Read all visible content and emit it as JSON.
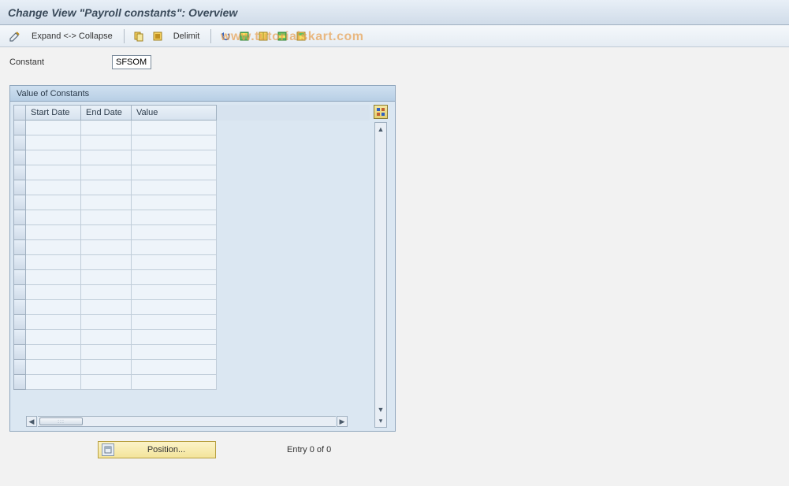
{
  "title": "Change View \"Payroll constants\": Overview",
  "toolbar": {
    "expand_collapse": "Expand <-> Collapse",
    "delimit": "Delimit"
  },
  "watermark": "www.tutorialskart.com",
  "field": {
    "label": "Constant",
    "value": "SFSOM"
  },
  "panel": {
    "title": "Value of Constants",
    "columns": {
      "start": "Start Date",
      "end": "End Date",
      "value": "Value"
    }
  },
  "position_btn": "Position...",
  "entry_text": "Entry 0 of 0"
}
